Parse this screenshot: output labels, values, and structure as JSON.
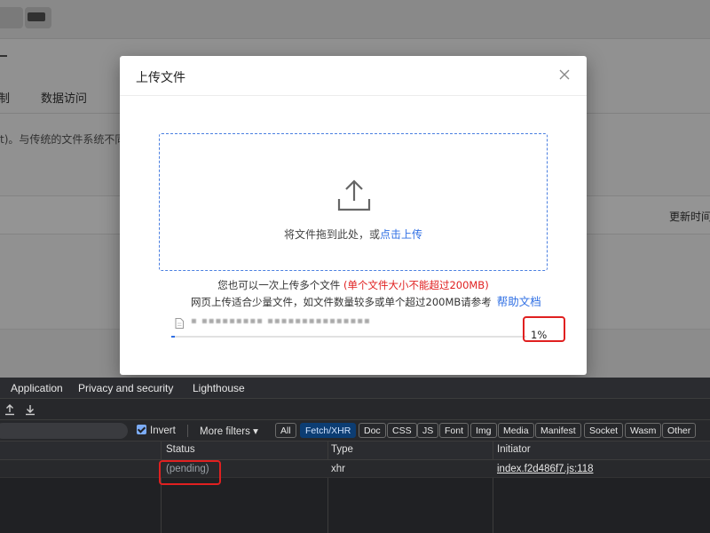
{
  "background_page": {
    "tabs": [
      "制",
      "数据访问"
    ],
    "description": "t)。与传统的文件系统不同",
    "column_updated": "更新时间"
  },
  "dialog": {
    "title": "上传文件",
    "close_icon": "close-icon",
    "dropzone": {
      "icon": "upload-icon",
      "text": "将文件拖到此处，或",
      "link": "点击上传"
    },
    "hint_line1": "您也可以一次上传多个文件",
    "hint_warning": "(单个文件大小不能超过200MB)",
    "hint_line2": "网页上传适合少量文件，如文件数量较多或单个超过200MB请参考",
    "help_link": "帮助文档",
    "upload_item": {
      "file_icon": "file-icon",
      "progress": 0.01,
      "percent_label": "1%"
    }
  },
  "devtools": {
    "tabs": [
      "Application",
      "Privacy and security",
      "Lighthouse"
    ],
    "icons": [
      "upload-icon",
      "download-icon"
    ],
    "invert_label": "Invert",
    "invert_checked": true,
    "more_filters": "More filters ▾",
    "filters": [
      "All",
      "Fetch/XHR",
      "Doc",
      "CSS",
      "JS",
      "Font",
      "Img",
      "Media",
      "Manifest",
      "Socket",
      "Wasm",
      "Other"
    ],
    "active_filter": "Fetch/XHR",
    "columns": [
      "Status",
      "Type",
      "Initiator"
    ],
    "rows": [
      {
        "status": "(pending)",
        "type": "xhr",
        "initiator": "index.f2d486f7.js:118"
      }
    ]
  },
  "colors": {
    "accent_blue": "#2f6fe4",
    "warning_red": "#e02020",
    "highlight_box": "#e02020",
    "devtools_bg": "#202124",
    "active_chip": "#0c3d73"
  }
}
